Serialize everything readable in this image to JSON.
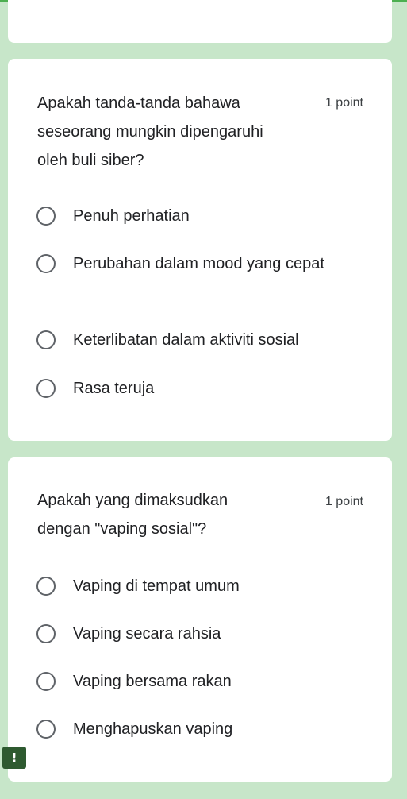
{
  "questions": [
    {
      "title": "Apakah tanda-tanda bahawa seseorang mungkin dipengaruhi oleh buli siber?",
      "points": "1 point",
      "options": [
        {
          "label": "Penuh perhatian",
          "selected": false
        },
        {
          "label": "Perubahan dalam mood yang cepat",
          "selected": false
        },
        {
          "label": "Keterlibatan dalam aktiviti sosial",
          "selected": false
        },
        {
          "label": "Rasa teruja",
          "selected": false
        }
      ]
    },
    {
      "title": "Apakah yang dimaksudkan dengan \"vaping sosial\"?",
      "points": "1 point",
      "options": [
        {
          "label": "Vaping di tempat umum",
          "selected": false
        },
        {
          "label": "Vaping secara rahsia",
          "selected": false
        },
        {
          "label": "Vaping bersama rakan",
          "selected": false
        },
        {
          "label": "Menghapuskan vaping",
          "selected": false
        }
      ]
    }
  ],
  "report_badge": {
    "icon": "exclamation-icon",
    "text": "!"
  },
  "colors": {
    "background": "#c7e6c9",
    "accent": "#4caf50",
    "card": "#ffffff"
  }
}
